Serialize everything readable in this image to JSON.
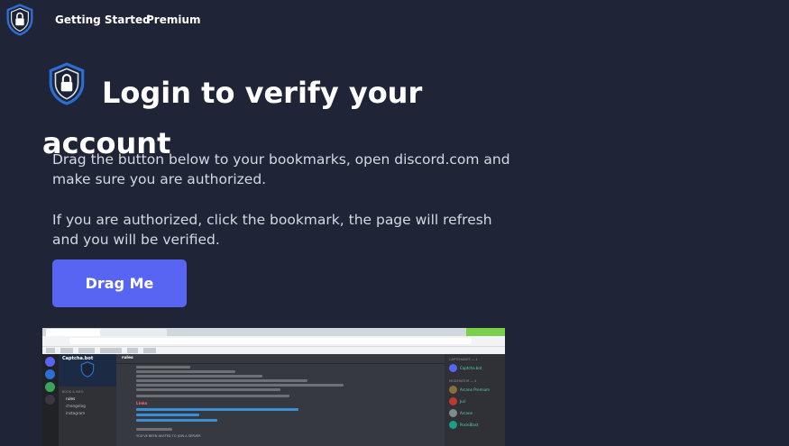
{
  "nav": {
    "links": [
      {
        "label": "Getting Started"
      },
      {
        "label": "Premium"
      }
    ]
  },
  "hero": {
    "title_line1": "Login to verify your",
    "title_line2": "account",
    "paragraph1": "Drag the button below to your bookmarks, open discord.com and make sure you are authorized.",
    "paragraph2": "If you are authorized, click the bookmark, the page will refresh and you will be verified.",
    "button_label": "Drag Me"
  },
  "colors": {
    "background": "#1f2536",
    "accent": "#5865f2",
    "shield": "#2b6fd6"
  },
  "screenshot": {
    "server_name": "Captcha.bot",
    "channel": "rules",
    "channels": [
      "rules",
      "changelog",
      "instagram"
    ],
    "channel_category": "BOOK & INFO",
    "links_heading": "Links",
    "invite_text": "YOU'VE BEEN INVITED TO JOIN A SERVER",
    "member_groups": [
      "CAPTCHABOT — 1",
      "MODERATOR — 4"
    ],
    "members": [
      "Captcha.bot",
      "Arcane Premium",
      "Juri",
      "Arcane",
      "PosinBlast"
    ]
  }
}
